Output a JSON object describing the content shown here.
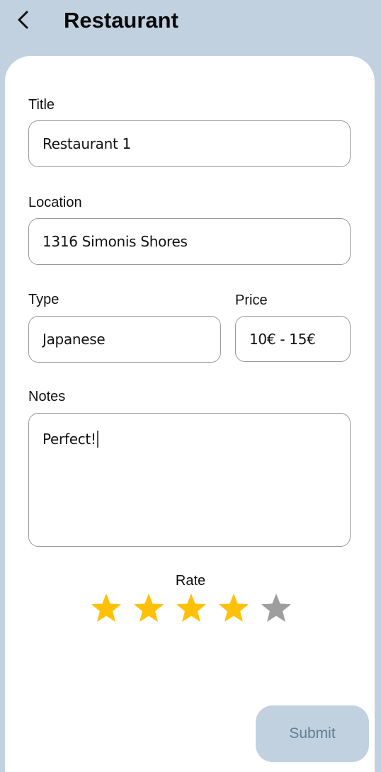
{
  "header": {
    "title": "Restaurant"
  },
  "form": {
    "title_label": "Title",
    "title_value": "Restaurant 1",
    "location_label": "Location",
    "location_value": "1316 Simonis Shores",
    "type_label": "Type",
    "type_value": "Japanese",
    "price_label": "Price",
    "price_value": "10€ - 15€",
    "notes_label": "Notes",
    "notes_value": "Perfect!",
    "rate_label": "Rate",
    "rating": 4,
    "rating_max": 5,
    "submit_label": "Submit"
  },
  "colors": {
    "background": "#c2d1e0",
    "star_active": "#ffc107",
    "star_inactive": "#9e9e9e",
    "submit_text": "#5f7f93"
  }
}
